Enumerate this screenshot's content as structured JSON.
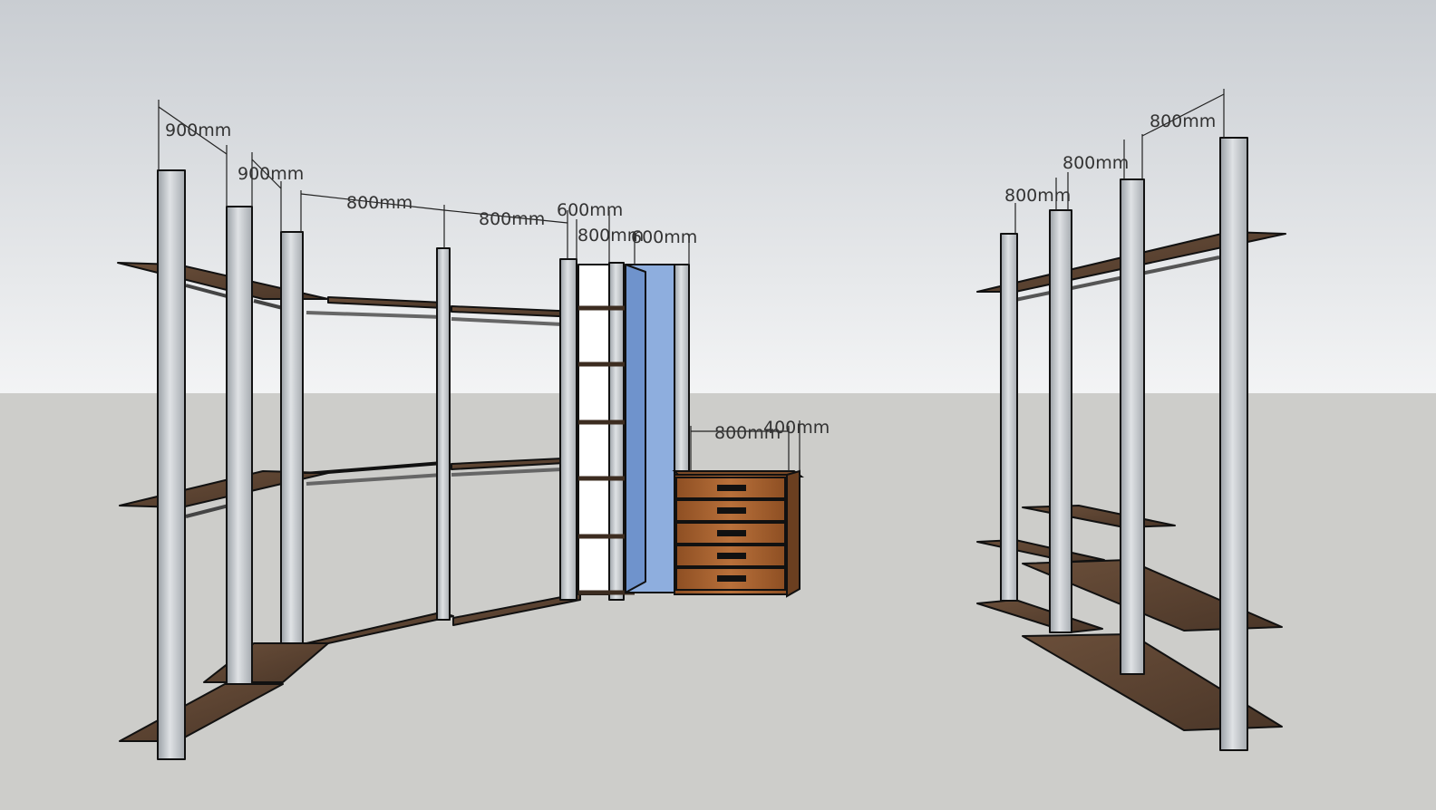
{
  "colors": {
    "sky_top": "#c9cdd2",
    "sky_bottom": "#f3f4f5",
    "ground": "#cdcdca",
    "pole": "#c8cbcf",
    "shelf": "#5a4332",
    "drawer": "#a15d2c",
    "glass": "#8eaede",
    "outline": "#111111"
  },
  "dimensions": {
    "left": [
      "900mm",
      "900mm",
      "800mm",
      "800mm",
      "600mm",
      "800mm",
      "600mm"
    ],
    "chest": [
      "800mm",
      "400mm"
    ],
    "right": [
      "800mm",
      "800mm",
      "800mm"
    ]
  }
}
